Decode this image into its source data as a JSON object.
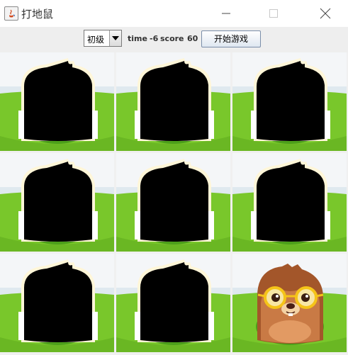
{
  "window": {
    "title": "打地鼠"
  },
  "toolbar": {
    "level_value": "初级",
    "time_label": "time",
    "time_value": "-6",
    "score_label": "score",
    "score_value": "60",
    "start_label": "开始游戏"
  },
  "board": {
    "rows": 3,
    "cols": 3,
    "cells": [
      {
        "state": "hidden"
      },
      {
        "state": "hidden"
      },
      {
        "state": "hidden"
      },
      {
        "state": "hidden"
      },
      {
        "state": "hidden"
      },
      {
        "state": "hidden"
      },
      {
        "state": "hidden"
      },
      {
        "state": "hidden"
      },
      {
        "state": "mole"
      }
    ]
  },
  "colors": {
    "grass": "#79c72b",
    "grass_dark": "#4c9f1a",
    "hole": "#7a3f22",
    "hole_dark": "#4c230f",
    "sky": "#f4f6f8",
    "mole": "#a3562a"
  }
}
